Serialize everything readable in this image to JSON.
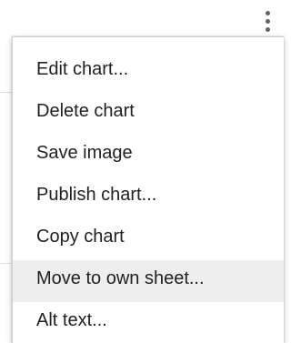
{
  "menu": {
    "items": [
      {
        "label": "Edit chart..."
      },
      {
        "label": "Delete chart"
      },
      {
        "label": "Save image"
      },
      {
        "label": "Publish chart..."
      },
      {
        "label": "Copy chart"
      },
      {
        "label": "Move to own sheet...",
        "highlighted": true
      },
      {
        "label": "Alt text..."
      }
    ]
  },
  "icons": {
    "more": "more-vertical-icon"
  },
  "colors": {
    "menu_background": "#ffffff",
    "highlight_background": "#eeeeee",
    "text": "#202124",
    "icon": "#5f6368"
  }
}
